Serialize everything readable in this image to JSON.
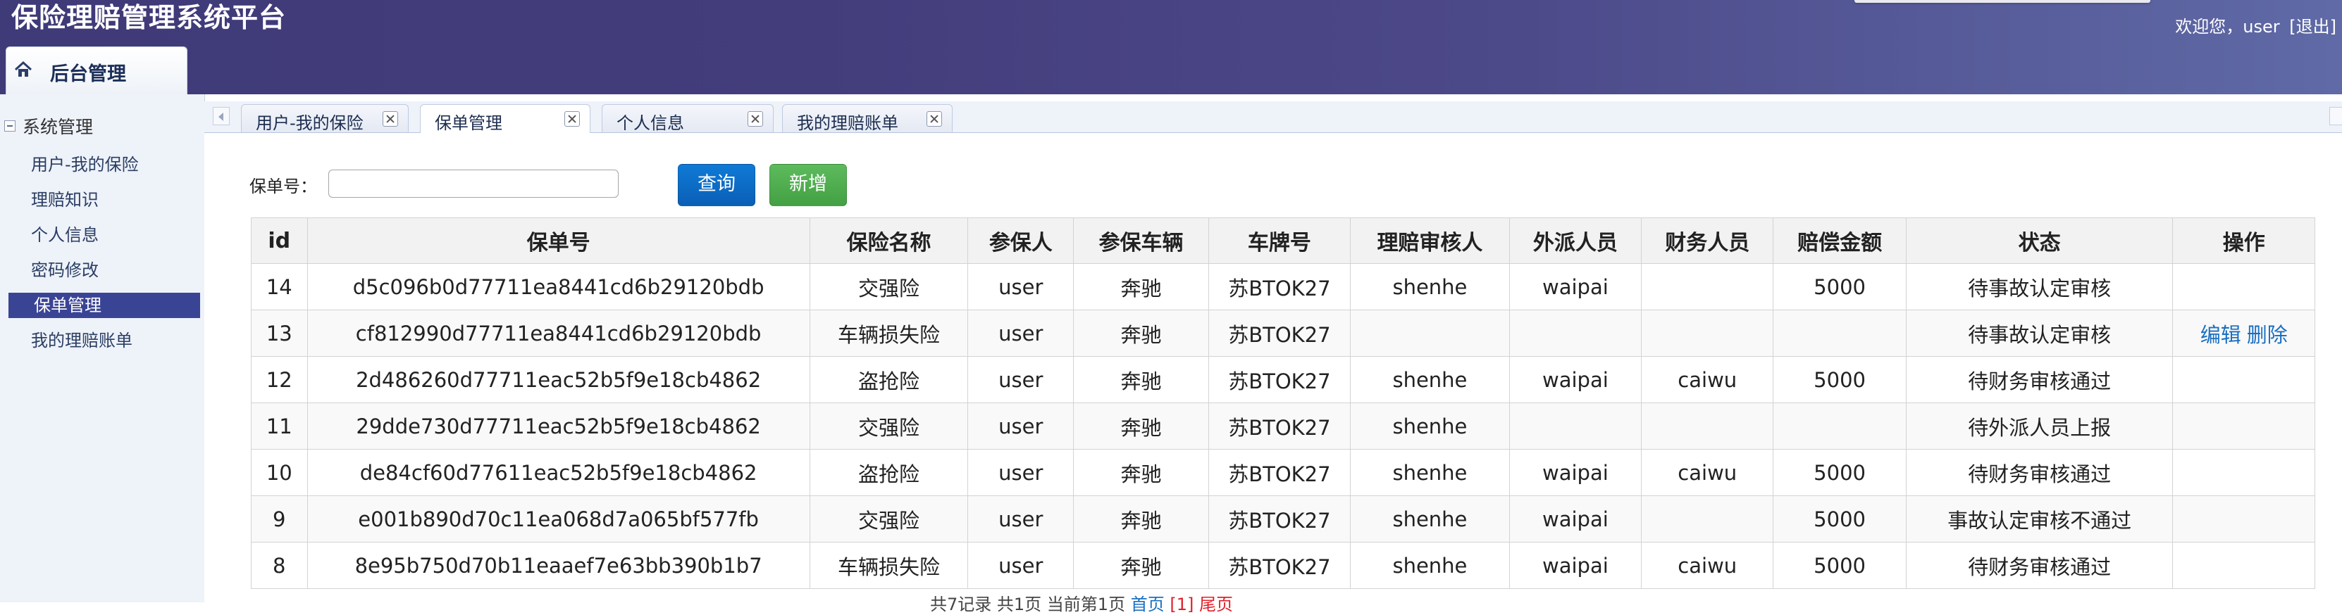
{
  "header": {
    "title": "保险理赔管理系统平台",
    "welcome": "欢迎您，user",
    "logout": "[退出]",
    "nav_tab": "后台管理"
  },
  "sidebar": {
    "group_label": "系统管理",
    "items": [
      {
        "label": "用户-我的保险",
        "active": false
      },
      {
        "label": "理赔知识",
        "active": false
      },
      {
        "label": "个人信息",
        "active": false
      },
      {
        "label": "密码修改",
        "active": false
      },
      {
        "label": "保单管理",
        "active": true
      },
      {
        "label": "我的理赔账单",
        "active": false
      }
    ]
  },
  "tabs": [
    {
      "label": "用户-我的保险",
      "active": false
    },
    {
      "label": "保单管理",
      "active": true
    },
    {
      "label": "个人信息",
      "active": false
    },
    {
      "label": "我的理赔账单",
      "active": false
    }
  ],
  "search": {
    "label": "保单号：",
    "value": "",
    "query_button": "查询",
    "add_button": "新增"
  },
  "table": {
    "columns": [
      "id",
      "保单号",
      "保险名称",
      "参保人",
      "参保车辆",
      "车牌号",
      "理赔审核人",
      "外派人员",
      "财务人员",
      "赔偿金额",
      "状态",
      "操作"
    ],
    "rows": [
      {
        "id": "14",
        "policy_no": "d5c096b0d77711ea8441cd6b29120bdb",
        "insurance": "交强险",
        "insured": "user",
        "vehicle": "奔驰",
        "plate": "苏BTOK27",
        "reviewer": "shenhe",
        "dispatcher": "waipai",
        "finance": "",
        "amount": "5000",
        "status": "待事故认定审核",
        "actions": []
      },
      {
        "id": "13",
        "policy_no": "cf812990d77711ea8441cd6b29120bdb",
        "insurance": "车辆损失险",
        "insured": "user",
        "vehicle": "奔驰",
        "plate": "苏BTOK27",
        "reviewer": "",
        "dispatcher": "",
        "finance": "",
        "amount": "",
        "status": "待事故认定审核",
        "actions": [
          "编辑",
          "删除"
        ]
      },
      {
        "id": "12",
        "policy_no": "2d486260d77711eac52b5f9e18cb4862",
        "insurance": "盗抢险",
        "insured": "user",
        "vehicle": "奔驰",
        "plate": "苏BTOK27",
        "reviewer": "shenhe",
        "dispatcher": "waipai",
        "finance": "caiwu",
        "amount": "5000",
        "status": "待财务审核通过",
        "actions": []
      },
      {
        "id": "11",
        "policy_no": "29dde730d77711eac52b5f9e18cb4862",
        "insurance": "交强险",
        "insured": "user",
        "vehicle": "奔驰",
        "plate": "苏BTOK27",
        "reviewer": "shenhe",
        "dispatcher": "",
        "finance": "",
        "amount": "",
        "status": "待外派人员上报",
        "actions": []
      },
      {
        "id": "10",
        "policy_no": "de84cf60d77611eac52b5f9e18cb4862",
        "insurance": "盗抢险",
        "insured": "user",
        "vehicle": "奔驰",
        "plate": "苏BTOK27",
        "reviewer": "shenhe",
        "dispatcher": "waipai",
        "finance": "caiwu",
        "amount": "5000",
        "status": "待财务审核通过",
        "actions": []
      },
      {
        "id": "9",
        "policy_no": "e001b890d70c11ea068d7a065bf577fb",
        "insurance": "交强险",
        "insured": "user",
        "vehicle": "奔驰",
        "plate": "苏BTOK27",
        "reviewer": "shenhe",
        "dispatcher": "waipai",
        "finance": "",
        "amount": "5000",
        "status": "事故认定审核不通过",
        "actions": []
      },
      {
        "id": "8",
        "policy_no": "8e95b750d70b11eaaef7e63bb390b1b7",
        "insurance": "车辆损失险",
        "insured": "user",
        "vehicle": "奔驰",
        "plate": "苏BTOK27",
        "reviewer": "shenhe",
        "dispatcher": "waipai",
        "finance": "caiwu",
        "amount": "5000",
        "status": "待财务审核通过",
        "actions": []
      }
    ]
  },
  "pager": {
    "summary": "共7记录 共1页 当前第1页",
    "first": "首页",
    "current": "[1]",
    "last": "尾页"
  },
  "colors": {
    "header": "#443d7c",
    "active_sidebar": "#3a4495",
    "query_button": "#0a6fcb",
    "add_button": "#4cae4c",
    "link": "#1a6fc2"
  }
}
